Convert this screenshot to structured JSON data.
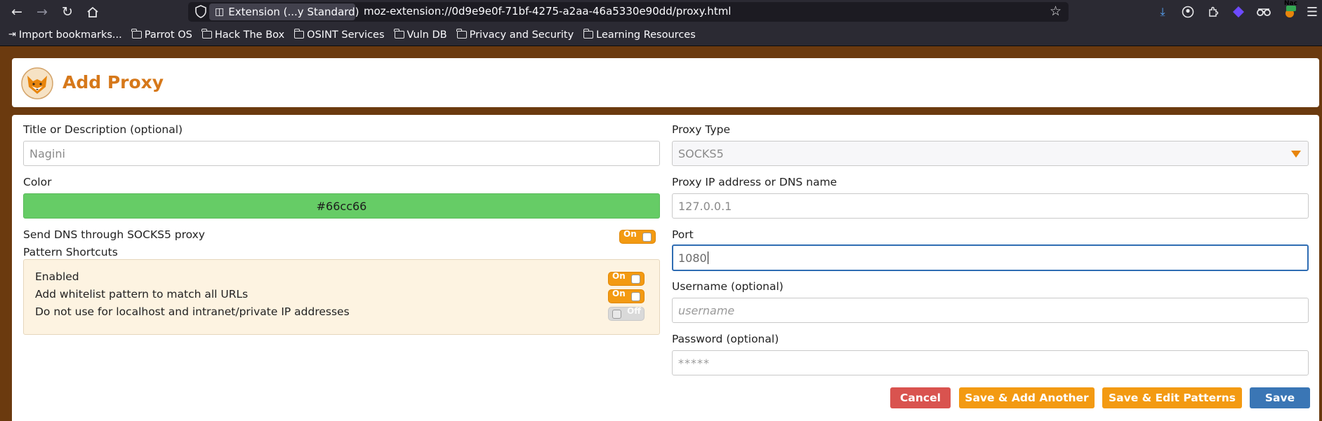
{
  "browser": {
    "extension_chip": "Extension (...y Standard)",
    "url": "moz-extension://0d9e9e0f-71bf-4275-a2aa-46a5330e90dd/proxy.html",
    "bookmarks": [
      {
        "label": "Import bookmarks..."
      },
      {
        "label": "Parrot OS"
      },
      {
        "label": "Hack The Box"
      },
      {
        "label": "OSINT Services"
      },
      {
        "label": "Vuln DB"
      },
      {
        "label": "Privacy and Security"
      },
      {
        "label": "Learning Resources"
      }
    ],
    "profile_badge": "Nac"
  },
  "page": {
    "title": "Add Proxy"
  },
  "form": {
    "title_label": "Title or Description (optional)",
    "title_value": "Nagini",
    "color_label": "Color",
    "color_value": "#66cc66",
    "dns_label": "Send DNS through SOCKS5 proxy",
    "dns_toggle": "On",
    "pattern_shortcuts_label": "Pattern Shortcuts",
    "patterns": [
      {
        "label": "Enabled",
        "toggle": "On"
      },
      {
        "label": "Add whitelist pattern to match all URLs",
        "toggle": "On"
      },
      {
        "label": "Do not use for localhost and intranet/private IP addresses",
        "toggle": "Off"
      }
    ],
    "proxy_type_label": "Proxy Type",
    "proxy_type_value": "SOCKS5",
    "ip_label": "Proxy IP address or DNS name",
    "ip_value": "127.0.0.1",
    "port_label": "Port",
    "port_value": "1080",
    "username_label": "Username (optional)",
    "username_placeholder": "username",
    "password_label": "Password (optional)",
    "password_placeholder": "*****"
  },
  "buttons": {
    "cancel": "Cancel",
    "save_add_another": "Save & Add Another",
    "save_edit_patterns": "Save & Edit Patterns",
    "save": "Save"
  },
  "colors": {
    "accent_orange": "#f39a12",
    "title_orange": "#d6781a",
    "cancel_red": "#d9534f",
    "save_blue": "#3a76b5",
    "page_brown": "#6b3a0f"
  }
}
